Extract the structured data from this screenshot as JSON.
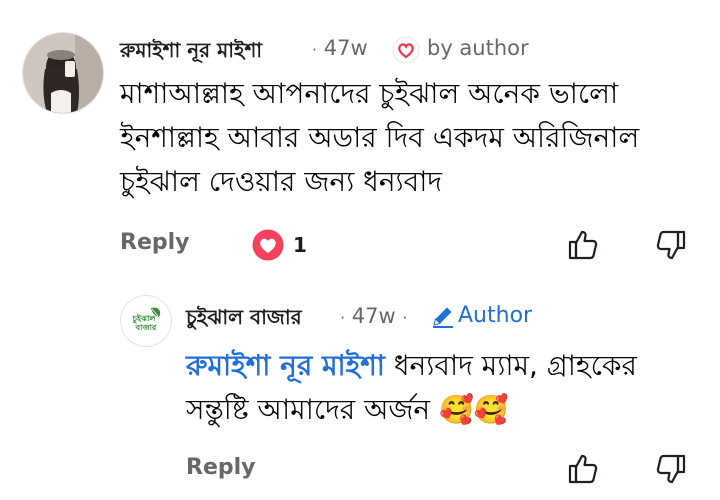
{
  "comment": {
    "author": "রুমাইশা নূর মাইশা",
    "time": "47w",
    "badge": "by author",
    "text": "মাশাআল্লাহ আপনাদের চুইঝাল অনেক ভালো ইনশাল্লাহ আবার অডার দিব একদম অরিজিনাল চুইঝাল দেওয়ার জন্য ধন্যবাদ",
    "reply_label": "Reply",
    "reaction_count": "1"
  },
  "reply": {
    "author": "চুইঝাল বাজার",
    "time": "47w",
    "author_tag": "Author",
    "mention": "রুমাইশা নূর মাইশা",
    "text": " ধন্যবাদ ম্যাম, গ্রাহকের সন্তুষ্টি আমাদের অর্জন ",
    "emojis": "🥰🥰",
    "reply_label": "Reply",
    "page_logo_text": "চুইঝাল বাজার"
  },
  "colors": {
    "heart_red": "#e8374c",
    "mention_blue": "#216fdb",
    "meta_gray": "#65676b",
    "logo_green": "#3a8a3a"
  }
}
